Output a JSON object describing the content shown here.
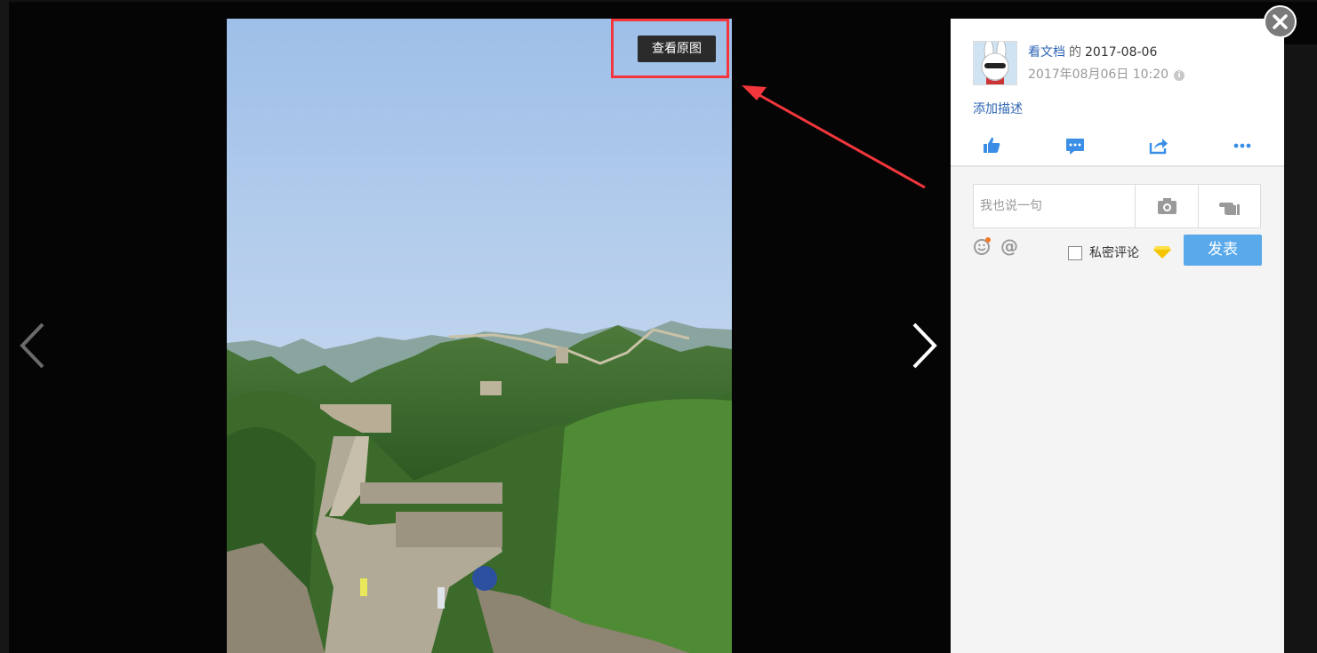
{
  "viewer": {
    "view_original_label": "查看原图",
    "prev_icon": "chevron-left-icon",
    "next_icon": "chevron-right-icon",
    "close_icon": "close-icon"
  },
  "post": {
    "author": "看文档",
    "separator": "的",
    "album_date": "2017-08-06",
    "timestamp": "2017年08月06日 10:20",
    "add_description": "添加描述"
  },
  "actions": [
    {
      "name": "like",
      "icon": "thumbs-up-icon"
    },
    {
      "name": "comment",
      "icon": "comment-icon"
    },
    {
      "name": "share",
      "icon": "share-icon"
    },
    {
      "name": "more",
      "icon": "more-icon"
    }
  ],
  "comment": {
    "placeholder": "我也说一句",
    "private_label": "私密评论",
    "submit_label": "发表"
  },
  "colors": {
    "accent": "#5aa9ea",
    "link": "#2d64b3",
    "highlight": "#f2363c"
  }
}
